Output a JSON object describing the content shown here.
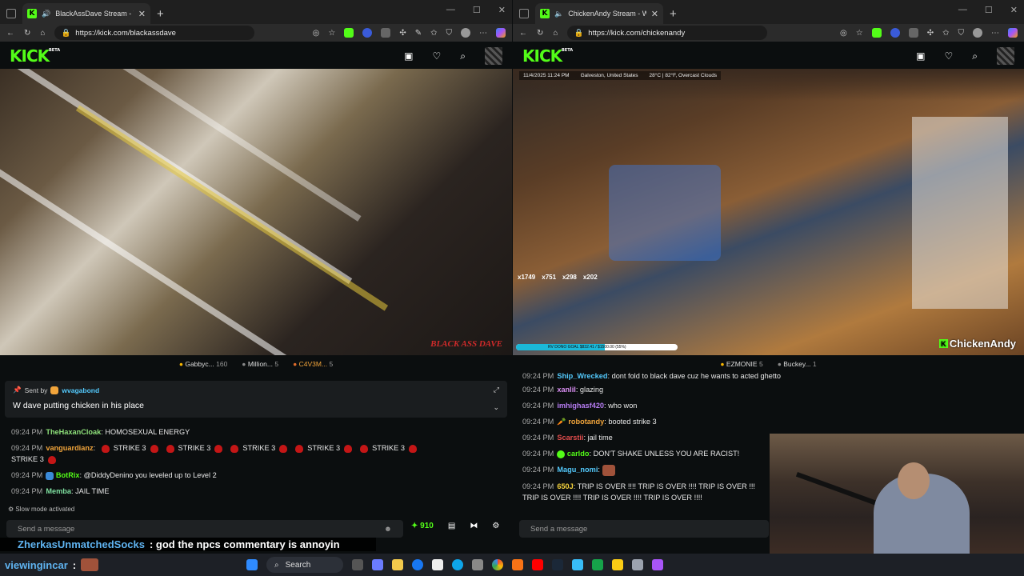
{
  "left": {
    "tab_title": "BlackAssDave Stream - Watc",
    "url": "https://kick.com/blackassdave",
    "logo": "KICK",
    "logo_badge": "BETA",
    "watermark": "BLACK ASS DAVE",
    "gifters": [
      {
        "name": "Gabbyc...",
        "count": "160"
      },
      {
        "name": "Million...",
        "count": "5"
      },
      {
        "name": "C4V3M...",
        "count": "5"
      }
    ],
    "pinned": {
      "sent_by": "Sent by",
      "user": "wvagabond",
      "message": "W dave putting chicken in his place"
    },
    "messages": [
      {
        "time": "09:24 PM",
        "user": "TheHaxanCloak",
        "color": "#8ee07a",
        "text": ": HOMOSEXUAL ENERGY"
      },
      {
        "time": "09:24 PM",
        "user": "vanguardianz",
        "color": "#f2a53b",
        "text": ":",
        "strikes": [
          "STRIKE 3",
          "STRIKE 3",
          "STRIKE 3",
          "STRIKE 3",
          "STRIKE 3",
          "STRIKE 3"
        ]
      },
      {
        "time": "09:24 PM",
        "user": "BotRix",
        "color": "#53fc18",
        "text": ": @DiddyDenino you leveled up to Level 2"
      },
      {
        "time": "09:24 PM",
        "user": "Memba",
        "color": "#7fe0a0",
        "text": ": JAIL TIME"
      }
    ],
    "slow_mode": "Slow mode activated",
    "input_placeholder": "Send a message",
    "points": "910"
  },
  "right": {
    "tab_title": "ChickenAndy Stream - Watc",
    "url": "https://kick.com/chickenandy",
    "logo": "KICK",
    "logo_badge": "BETA",
    "overlay": {
      "datetime": "11/4/2025 11:24 PM",
      "location": "Galveston, United States",
      "weather": "28°C | 82°F, Overcast Clouds"
    },
    "stats": [
      "x1749",
      "x751",
      "x298",
      "x202"
    ],
    "goal_text": "RV DONO GOAL $832.41 / $1500.00 (55%)",
    "goal_progress": 0.55,
    "channel_label": "ChickenAndy",
    "gifters": [
      {
        "name": "EZMONIE",
        "count": "5"
      },
      {
        "name": "Buckey...",
        "count": "1"
      }
    ],
    "messages": [
      {
        "time": "09:24 PM",
        "user": "Ship_Wrecked",
        "color": "#53c9fc",
        "text": ": dont fold to black dave cuz he wants to acted ghetto"
      },
      {
        "time": "09:24 PM",
        "user": "xanlil",
        "color": "#d98ef2",
        "text": ": glazing"
      },
      {
        "time": "09:24 PM",
        "user": "imhighasf420",
        "color": "#b67cf2",
        "text": ": who won"
      },
      {
        "time": "09:24 PM",
        "user": "robotandy",
        "color": "#f2a53b",
        "text": ": booted strike 3"
      },
      {
        "time": "09:24 PM",
        "user": "Scarstii",
        "color": "#e34d4d",
        "text": ": jail time"
      },
      {
        "time": "09:24 PM",
        "user": "carldo",
        "color": "#53fc18",
        "text": ": DON'T SHAKE UNLESS YOU ARE RACIST!"
      },
      {
        "time": "09:24 PM",
        "user": "Magu_nomi",
        "color": "#53c9fc",
        "text": ":"
      },
      {
        "time": "09:24 PM",
        "user": "650J",
        "color": "#f2d03b",
        "text": ": TRIP IS OVER !!!!   TRIP IS OVER !!!!   TRIP IS OVER !!!"
      },
      {
        "time": "",
        "user": "",
        "color": "#fff",
        "text": "TRIP IS OVER !!!!   TRIP IS OVER !!!!   TRIP IS OVER !!!!"
      }
    ],
    "input_placeholder": "Send a message"
  },
  "overlay_comment": {
    "user": "ZherkasUnmatchedSocks",
    "text": ": god the npcs commentary is annoyin"
  },
  "taskbar": {
    "user": "viewingincar",
    "sep": ":",
    "search_label": "Search"
  }
}
